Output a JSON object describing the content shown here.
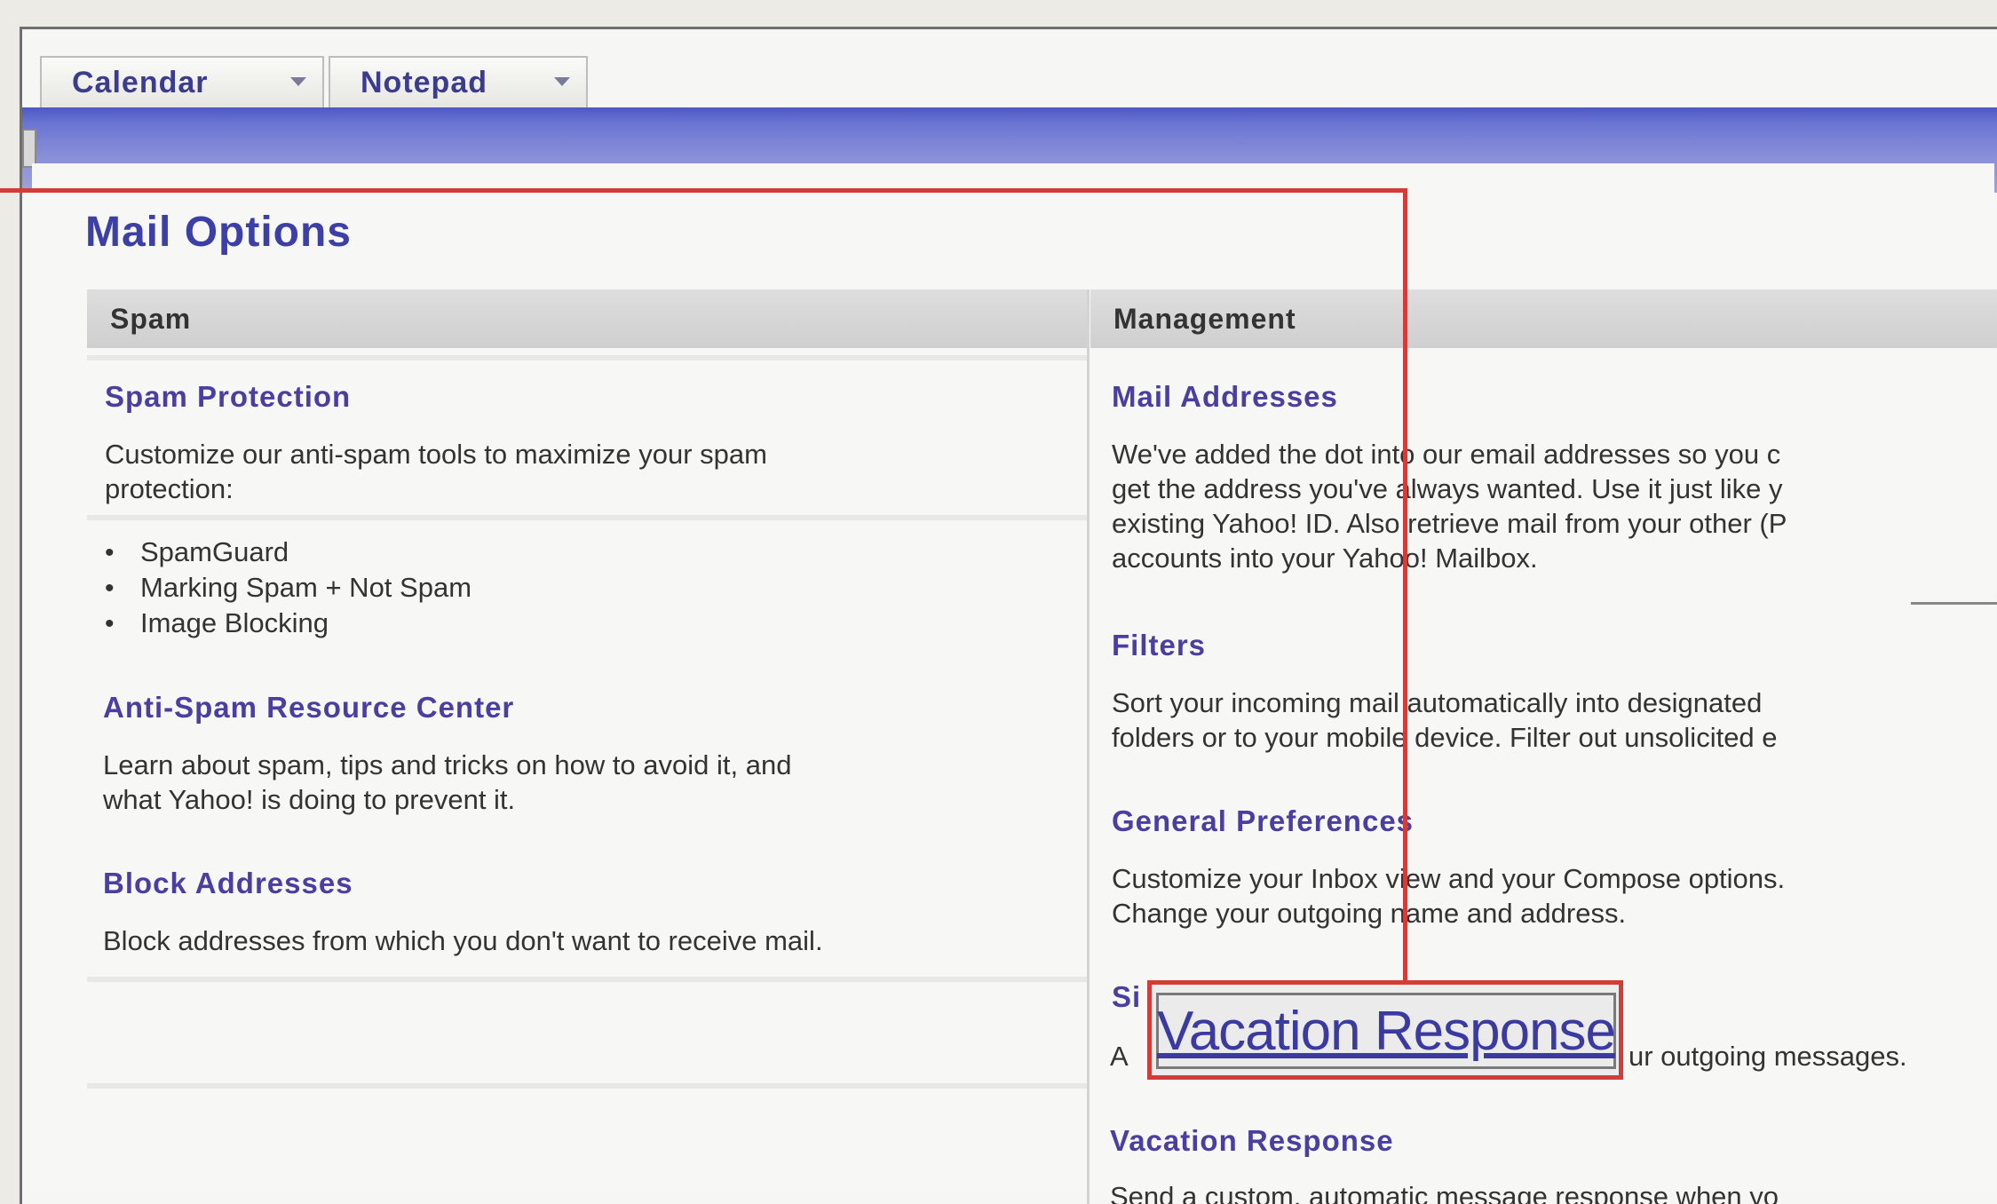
{
  "tabs": [
    {
      "label": "Calendar"
    },
    {
      "label": "Notepad"
    }
  ],
  "page_title": "Mail Options",
  "spam": {
    "header": "Spam",
    "sections": [
      {
        "title": "Spam Protection",
        "desc_lines": [
          "Customize our anti-spam tools to maximize your spam",
          "protection:"
        ],
        "bullets": [
          "SpamGuard",
          "Marking Spam + Not Spam",
          "Image Blocking"
        ]
      },
      {
        "title": "Anti-Spam Resource Center",
        "desc_lines": [
          "Learn about spam, tips and tricks on how to avoid it, and",
          "what Yahoo! is doing to prevent it."
        ]
      },
      {
        "title": "Block Addresses",
        "desc_lines": [
          "Block addresses from which you don't want to receive mail."
        ]
      }
    ]
  },
  "management": {
    "header": "Management",
    "sections": [
      {
        "title": "Mail Addresses",
        "desc_lines": [
          "We've added the dot into our email addresses so you c",
          "get the address you've always wanted. Use it just like y",
          "existing Yahoo! ID. Also retrieve mail from your other (P",
          "accounts into your Yahoo! Mailbox."
        ]
      },
      {
        "title": "Filters",
        "desc_lines": [
          "Sort your incoming mail automatically into designated",
          "folders or to your mobile device. Filter out unsolicited e"
        ]
      },
      {
        "title": "General Preferences",
        "desc_lines": [
          "Customize your Inbox view and your Compose options.",
          "Change your outgoing name and address."
        ]
      },
      {
        "title_partial": "Si",
        "desc_partial_start": "A",
        "desc_partial_end": "ur outgoing messages."
      },
      {
        "title": "Vacation Response",
        "desc_lines": [
          "Send a custom, automatic message response when yo"
        ]
      }
    ]
  },
  "callout": {
    "label": "Vacation Response",
    "color": "#d23d3a"
  },
  "colors": {
    "accent_blue": "#4d58c7",
    "link_purple": "#4a3fa0",
    "title_blue": "#3b3fa6"
  }
}
